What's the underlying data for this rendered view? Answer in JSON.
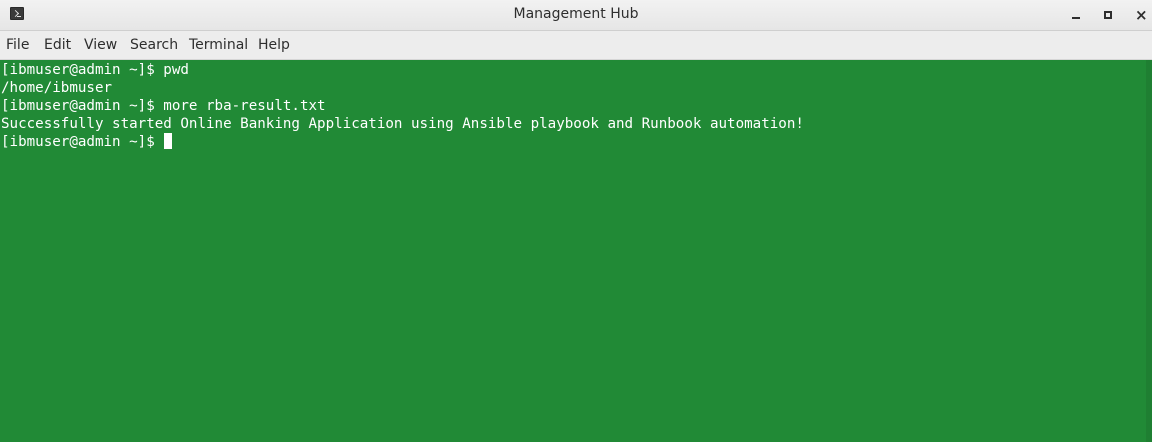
{
  "window": {
    "title": "Management Hub",
    "icon": "terminal-icon"
  },
  "menu": {
    "items": [
      "File",
      "Edit",
      "View",
      "Search",
      "Terminal",
      "Help"
    ]
  },
  "terminal": {
    "background": "#218a36",
    "foreground": "#ffffff",
    "lines": [
      "[ibmuser@admin ~]$ pwd",
      "/home/ibmuser",
      "[ibmuser@admin ~]$ more rba-result.txt",
      "Successfully started Online Banking Application using Ansible playbook and Runbook automation!",
      "[ibmuser@admin ~]$ "
    ]
  }
}
